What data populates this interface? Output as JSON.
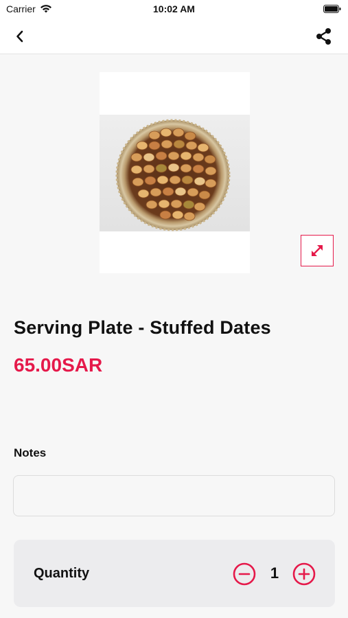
{
  "status_bar": {
    "carrier": "Carrier",
    "time": "10:02 AM",
    "wifi_icon": "wifi-icon",
    "battery_icon": "battery-icon"
  },
  "nav": {
    "back_icon": "chevron-left-icon",
    "share_icon": "share-icon"
  },
  "product": {
    "image_subject": "round serving plate of stuffed dates",
    "expand_icon": "expand-arrows-icon",
    "title": "Serving Plate - Stuffed Dates",
    "price": "65.00SAR"
  },
  "notes": {
    "label": "Notes",
    "value": "",
    "placeholder": ""
  },
  "quantity": {
    "label": "Quantity",
    "value": "1",
    "decrement_icon": "minus-circle-icon",
    "increment_icon": "plus-circle-icon"
  },
  "colors": {
    "accent": "#e5194a",
    "background": "#f7f7f7",
    "card": "#ececee"
  }
}
